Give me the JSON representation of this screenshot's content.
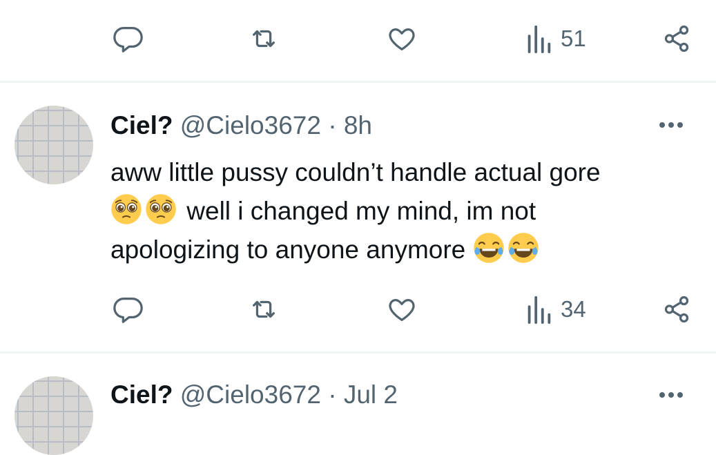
{
  "top_tweet": {
    "views": "51"
  },
  "tweet": {
    "name": "Ciel?",
    "handle": "@Cielo3672",
    "separator": "·",
    "time": "8h",
    "line1": "aww little pussy couldn’t handle actual gore",
    "line2_text": "well i changed my mind, im not",
    "line3_text": "apologizing to anyone anymore",
    "emoji_line2": [
      "pleading-face",
      "pleading-face"
    ],
    "emoji_line3": [
      "face-with-tears-of-joy",
      "face-with-tears-of-joy"
    ],
    "views": "34"
  },
  "next_tweet": {
    "name": "Ciel?",
    "handle": "@Cielo3672",
    "separator": "·",
    "time": "Jul 2"
  },
  "colors": {
    "icon_gray": "#536471",
    "text": "#0f1419",
    "divider": "#eff3f4"
  }
}
